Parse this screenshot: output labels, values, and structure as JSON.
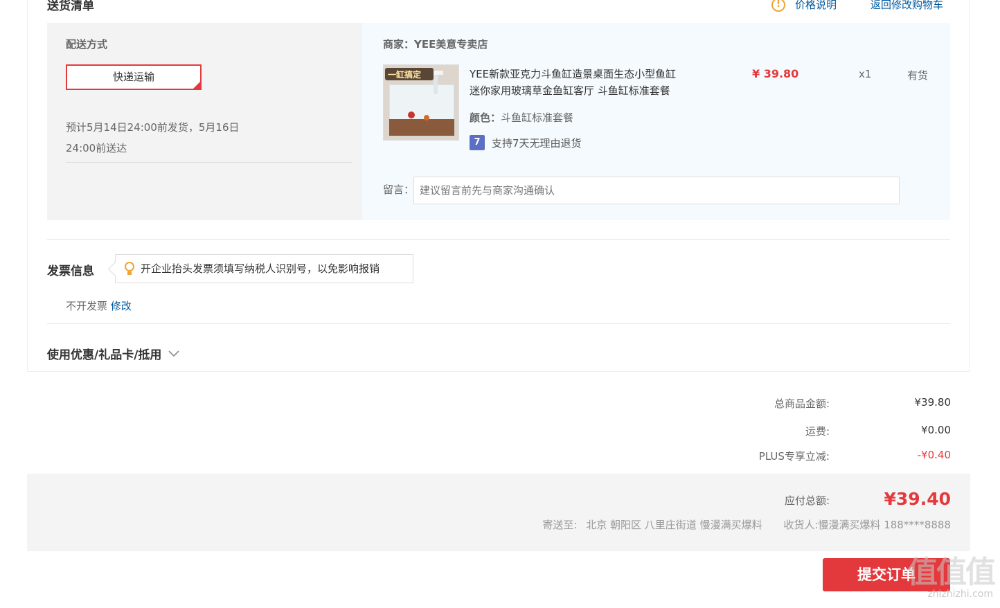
{
  "header": {
    "title": "送货清单",
    "price_note": "价格说明",
    "back_to_cart": "返回修改购物车"
  },
  "shipping": {
    "method_label": "配送方式",
    "method_value": "快递运输",
    "eta_line1": "预计5月14日24:00前发货，5月16日",
    "eta_line2": "24:00前送达"
  },
  "merchant": {
    "label": "商家：",
    "name": "YEE美意专卖店"
  },
  "product": {
    "title_line1": "YEE新款亚克力斗鱼缸造景桌面生态小型鱼缸",
    "title_line2": "迷你家用玻璃草金鱼缸客厅 斗鱼缸标准套餐",
    "image_badge": "一缸搞定",
    "price": "¥ 39.80",
    "qty": "x1",
    "stock": "有货",
    "color_label": "颜色：",
    "color_value": "斗鱼缸标准套餐",
    "return_icon_text": "7",
    "return_policy": "支持7天无理由退货"
  },
  "message": {
    "label": "留言：",
    "placeholder": "建议留言前先与商家沟通确认"
  },
  "invoice": {
    "title": "发票信息",
    "tip": "开企业抬头发票须填写纳税人识别号，以免影响报销",
    "status": "不开发票",
    "edit": "修改"
  },
  "coupon": {
    "title": "使用优惠/礼品卡/抵用"
  },
  "summary": {
    "goods_label": "总商品金额:",
    "goods_value": "¥39.80",
    "freight_label": "运费:",
    "freight_value": "¥0.00",
    "plus_label": "PLUS专享立减:",
    "plus_value": "-¥0.40"
  },
  "payment": {
    "total_label": "应付总额:",
    "total_value": "¥39.40",
    "ship_to_label": "寄送至:",
    "ship_to_value": "北京 朝阳区 八里庄街道 慢漫满买爆料",
    "receiver_label": "收货人:",
    "receiver_value": "慢漫满买爆料 188****8888"
  },
  "submit_label": "提交订单",
  "watermark": {
    "main": "值值值",
    "sub": "zhizhizhi.com"
  },
  "colors": {
    "accent_red": "#e4393c",
    "link_blue": "#005aa0",
    "discount_orange": "#e4393c"
  }
}
